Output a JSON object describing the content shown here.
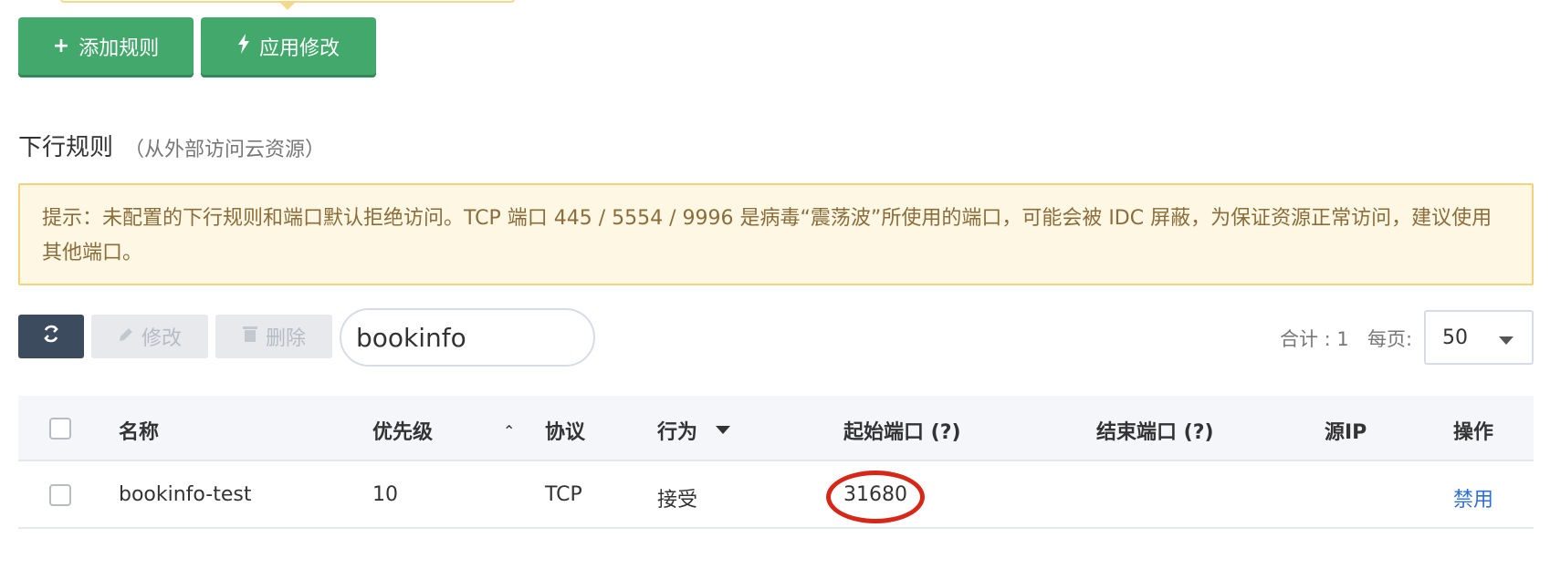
{
  "toolbar": {
    "add_rule_label": "添加规则",
    "apply_changes_label": "应用修改"
  },
  "section": {
    "title": "下行规则",
    "subtitle": "（从外部访问云资源）"
  },
  "notice": {
    "text": "提示：未配置的下行规则和端口默认拒绝访问。TCP 端口 445 / 5554 / 9996 是病毒“震荡波”所使用的端口，可能会被 IDC 屏蔽，为保证资源正常访问，建议使用其他端口。"
  },
  "actions": {
    "edit_label": "修改",
    "delete_label": "删除",
    "search_value": "bookinfo"
  },
  "pagination": {
    "total_text": "合计 : 1",
    "per_page_label": "每页:",
    "per_page_value": "50"
  },
  "table": {
    "columns": [
      "名称",
      "优先级",
      "协议",
      "行为",
      "起始端口 (?)",
      "结束端口 (?)",
      "源IP",
      "操作"
    ],
    "rows": [
      {
        "name": "bookinfo-test",
        "priority": "10",
        "protocol": "TCP",
        "action": "接受",
        "start_port": "31680",
        "end_port": "",
        "source_ip": "",
        "operation": "禁用"
      }
    ]
  },
  "icons": {
    "add": "plus-icon",
    "apply": "bolt-icon",
    "refresh": "refresh-icon",
    "edit": "pencil-icon",
    "delete": "trash-icon"
  },
  "colors": {
    "primary_green": "#43a86b",
    "notice_bg": "#fdf7e3",
    "notice_border": "#f3d27a",
    "notice_text": "#8a6d3b",
    "dark_button": "#3d4b5e",
    "link_blue": "#2f6fd6",
    "highlight_red": "#d62718"
  }
}
